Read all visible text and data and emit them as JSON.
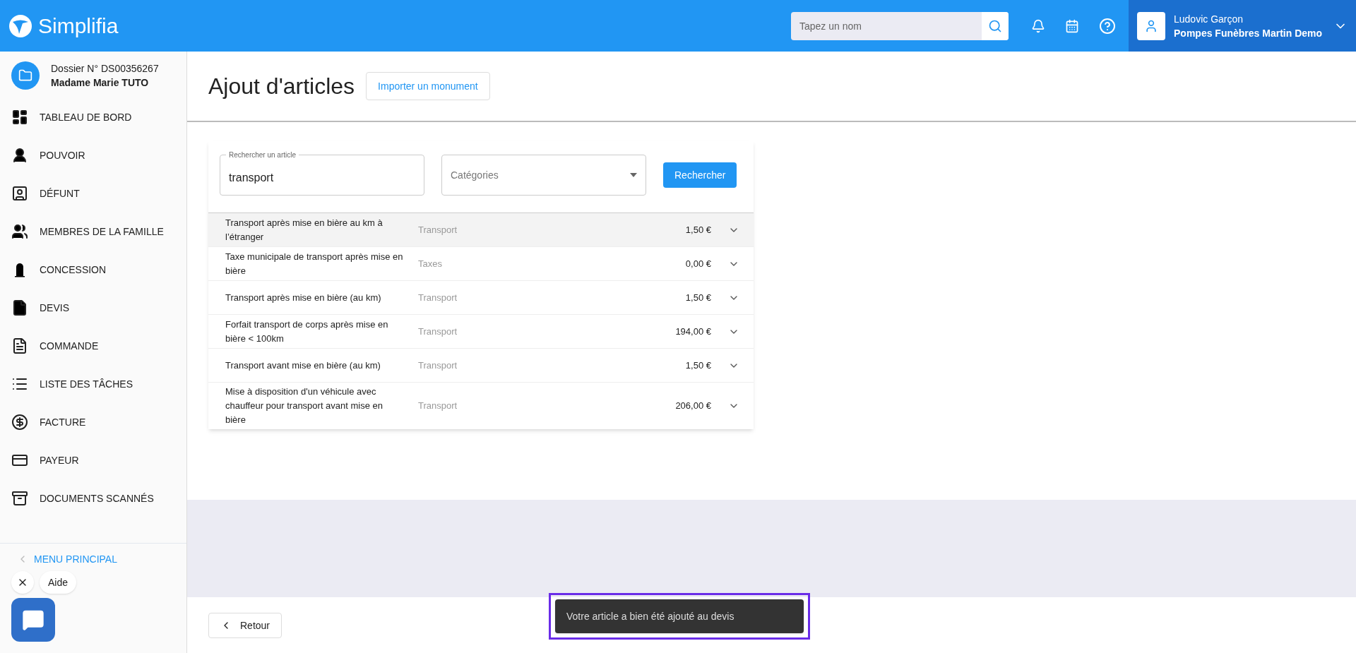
{
  "header": {
    "logo": "Simplifia",
    "search": {
      "placeholder": "Tapez un nom"
    },
    "user": {
      "name": "Ludovic Garçon",
      "company": "Pompes Funèbres Martin Demo"
    }
  },
  "sidebar": {
    "dossier": {
      "number": "Dossier N° DS00356267",
      "client": "Madame Marie TUTO"
    },
    "items": [
      {
        "kind": "dashboard",
        "label": "TABLEAU DE BORD"
      },
      {
        "kind": "person",
        "label": "POUVOIR"
      },
      {
        "kind": "badge",
        "label": "DÉFUNT"
      },
      {
        "kind": "people",
        "label": "MEMBRES DE LA FAMILLE"
      },
      {
        "kind": "tomb",
        "label": "CONCESSION"
      },
      {
        "kind": "file",
        "label": "DEVIS"
      },
      {
        "kind": "doc",
        "label": "COMMANDE"
      },
      {
        "kind": "list",
        "label": "LISTE DES TÂCHES"
      },
      {
        "kind": "money",
        "label": "FACTURE"
      },
      {
        "kind": "card",
        "label": "PAYEUR"
      },
      {
        "kind": "archive",
        "label": "DOCUMENTS SCANNÉS"
      }
    ],
    "main_menu": "MENU PRINCIPAL"
  },
  "page": {
    "title": "Ajout d'articles",
    "import_button": "Importer un monument"
  },
  "search": {
    "label": "Rechercher un article",
    "value": "transport",
    "category_placeholder": "Catégories",
    "button": "Rechercher"
  },
  "articles": [
    {
      "name": "Transport après mise en bière au km à l’étranger",
      "category": "Transport",
      "price": "1,50 €",
      "selected": true
    },
    {
      "name": "Taxe municipale de transport après mise en bière",
      "category": "Taxes",
      "price": "0,00 €",
      "selected": false
    },
    {
      "name": "Transport après mise en bière (au km)",
      "category": "Transport",
      "price": "1,50 €",
      "selected": false
    },
    {
      "name": "Forfait transport de corps après mise en bière < 100km",
      "category": "Transport",
      "price": "194,00 €",
      "selected": false
    },
    {
      "name": "Transport avant mise en bière (au km)",
      "category": "Transport",
      "price": "1,50 €",
      "selected": false
    },
    {
      "name": "Mise à disposition d'un véhicule avec chauffeur pour transport avant mise en bière",
      "category": "Transport",
      "price": "206,00 €",
      "selected": false
    }
  ],
  "chat": {
    "label": "Aide"
  },
  "footer": {
    "back_button": "Retour"
  },
  "toast": {
    "message": "Votre article a bien été ajouté au devis"
  }
}
